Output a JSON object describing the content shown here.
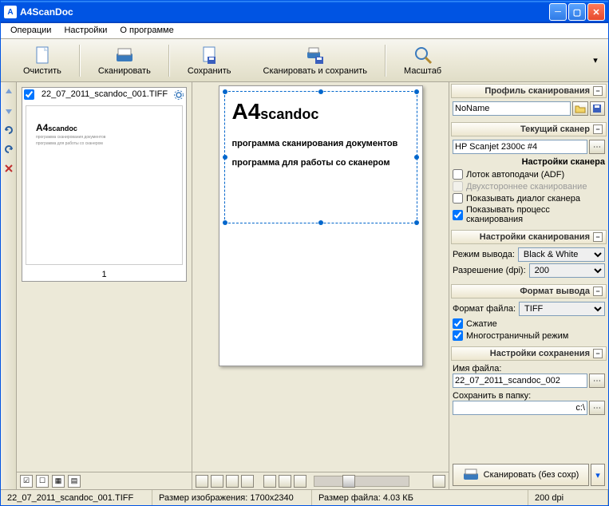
{
  "title": "A4ScanDoc",
  "menu": {
    "operations": "Операции",
    "settings": "Настройки",
    "about": "О программе"
  },
  "toolbar": {
    "clear": "Очистить",
    "scan": "Сканировать",
    "save": "Сохранить",
    "scan_save": "Сканировать и сохранить",
    "zoom": "Масштаб"
  },
  "thumb": {
    "filename": "22_07_2011_scandoc_001.TIFF",
    "page": "1",
    "brand_big": "A4",
    "brand_small": "scandoc",
    "brand_sub1": "программа сканирования документов",
    "brand_sub2": "программа для работы со сканером"
  },
  "doc": {
    "brand_big": "A4",
    "brand_small": "scandoc",
    "line1": "программа сканирования  документов",
    "line2": "программа для работы со сканером"
  },
  "right": {
    "profile_header": "Профиль сканирования",
    "profile_value": "NoName",
    "scanner_header": "Текущий сканер",
    "scanner_value": "HP Scanjet 2300c #4",
    "scanner_settings_header": "Настройки сканера",
    "adf": "Лоток автоподачи (ADF)",
    "duplex": "Двухстороннее сканирование",
    "show_dialog": "Показывать диалог сканера",
    "show_progress": "Показывать процесс сканирования",
    "scan_settings_header": "Настройки сканирования",
    "output_mode_label": "Режим вывода:",
    "output_mode_value": "Black & White",
    "dpi_label": "Разрешение (dpi):",
    "dpi_value": "200",
    "format_header": "Формат вывода",
    "file_format_label": "Формат файла:",
    "file_format_value": "TIFF",
    "compress": "Сжатие",
    "multipage": "Многостраничный режим",
    "save_header": "Настройки сохранения",
    "filename_label": "Имя файла:",
    "filename_value": "22_07_2011_scandoc_002",
    "folder_label": "Сохранить в папку:",
    "folder_value": "c:\\",
    "scan_nosave": "Сканировать (без сохр)"
  },
  "status": {
    "file": "22_07_2011_scandoc_001.TIFF",
    "image_size": "Размер изображения: 1700x2340",
    "file_size": "Размер файла: 4.03 КБ",
    "dpi": "200 dpi"
  }
}
